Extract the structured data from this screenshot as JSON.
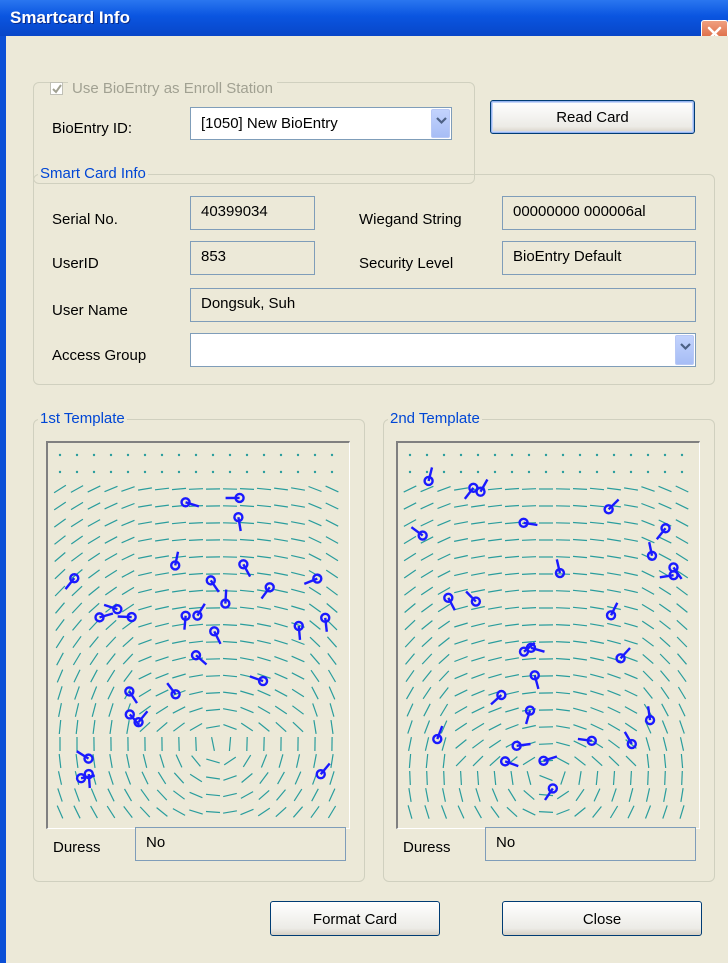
{
  "window": {
    "title": "Smartcard Info"
  },
  "enroll": {
    "checkbox_label": "Use BioEntry as Enroll Station",
    "checked": true,
    "bioentry_id_label": "BioEntry ID:",
    "bioentry_id_value": "[1050] New BioEntry",
    "read_card_label": "Read Card"
  },
  "info": {
    "title": "Smart Card Info",
    "serial_label": "Serial No.",
    "serial_value": "40399034",
    "wiegand_label": "Wiegand String",
    "wiegand_value": "00000000 000006al",
    "userid_label": "UserID",
    "userid_value": "853",
    "security_label": "Security Level",
    "security_value": "BioEntry Default",
    "username_label": "User Name",
    "username_value": "Dongsuk, Suh",
    "access_label": "Access Group",
    "access_value": ""
  },
  "template1": {
    "title": "1st Template",
    "duress_label": "Duress",
    "duress_value": "No"
  },
  "template2": {
    "title": "2nd Template",
    "duress_label": "Duress",
    "duress_value": "No"
  },
  "buttons": {
    "format_label": "Format Card",
    "close_label": "Close"
  },
  "colors": {
    "title_bar": "#0a55e0",
    "dialog_bg": "#ece9d8",
    "group_title": "#0046d5",
    "ridge": "#2a9d9d",
    "minutiae": "#1a1aff"
  }
}
